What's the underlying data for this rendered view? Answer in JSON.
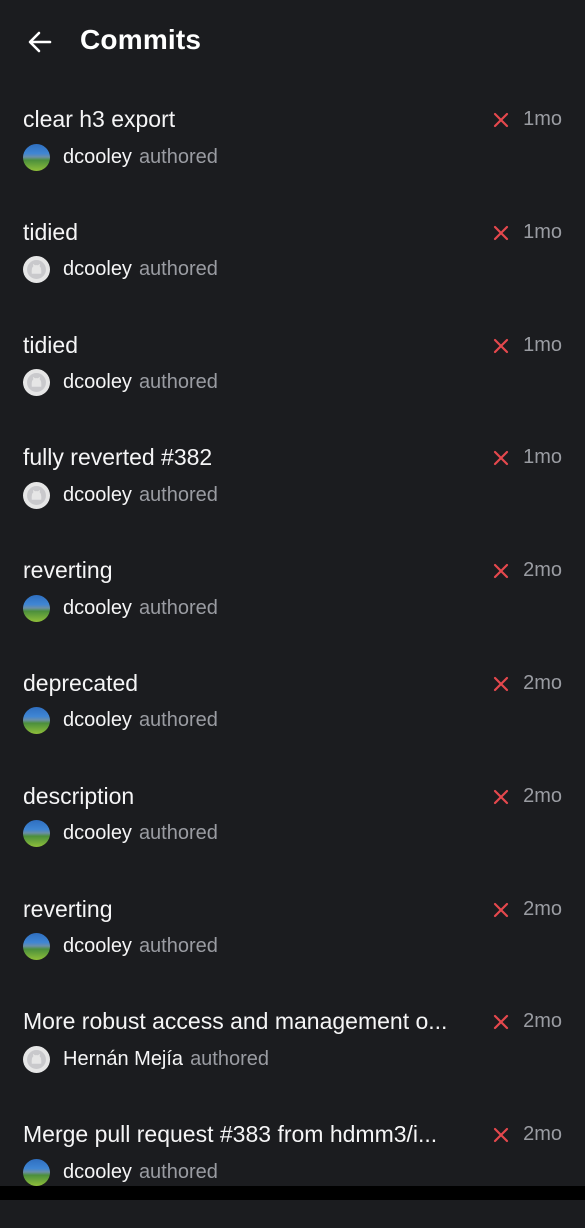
{
  "header": {
    "title": "Commits",
    "back_icon": "arrow-left-icon"
  },
  "colors": {
    "background": "#1b1c1f",
    "failed_status": "#e5484d",
    "muted_text": "#9a9ca2"
  },
  "commits": [
    {
      "message": "clear h3 export",
      "author": "dcooley",
      "role": "authored",
      "age": "1mo",
      "status": "failed",
      "avatar": "landscape"
    },
    {
      "message": "tidied",
      "author": "dcooley",
      "role": "authored",
      "age": "1mo",
      "status": "failed",
      "avatar": "github"
    },
    {
      "message": "tidied",
      "author": "dcooley",
      "role": "authored",
      "age": "1mo",
      "status": "failed",
      "avatar": "github"
    },
    {
      "message": "fully reverted #382",
      "author": "dcooley",
      "role": "authored",
      "age": "1mo",
      "status": "failed",
      "avatar": "github"
    },
    {
      "message": "reverting",
      "author": "dcooley",
      "role": "authored",
      "age": "2mo",
      "status": "failed",
      "avatar": "landscape"
    },
    {
      "message": "deprecated",
      "author": "dcooley",
      "role": "authored",
      "age": "2mo",
      "status": "failed",
      "avatar": "landscape"
    },
    {
      "message": "description",
      "author": "dcooley",
      "role": "authored",
      "age": "2mo",
      "status": "failed",
      "avatar": "landscape"
    },
    {
      "message": "reverting",
      "author": "dcooley",
      "role": "authored",
      "age": "2mo",
      "status": "failed",
      "avatar": "landscape"
    },
    {
      "message": "More robust access and management o...",
      "author": "Hernán Mejía",
      "role": "authored",
      "age": "2mo",
      "status": "failed",
      "avatar": "github"
    },
    {
      "message": "Merge pull request #383 from hdmm3/i...",
      "author": "dcooley",
      "role": "authored",
      "age": "2mo",
      "status": "failed",
      "avatar": "landscape"
    }
  ]
}
